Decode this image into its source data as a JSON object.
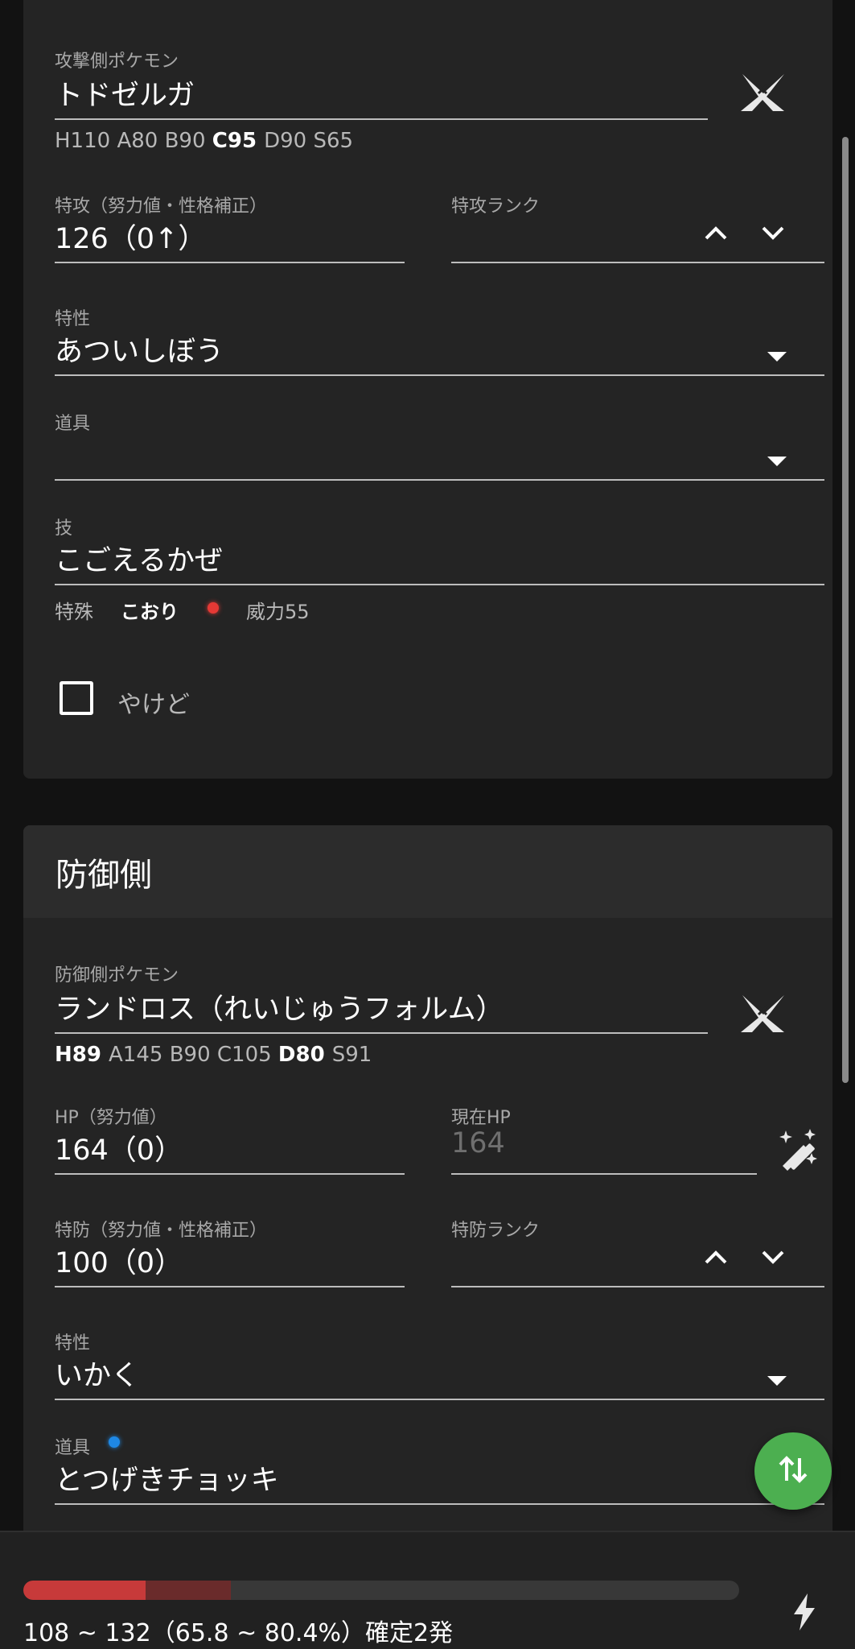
{
  "attacker": {
    "pokemon_label": "攻撃側ポケモン",
    "pokemon_value": "トドゼルガ",
    "stats": [
      {
        "text": "H110",
        "bold": false
      },
      {
        "text": "A80",
        "bold": false
      },
      {
        "text": "B90",
        "bold": false
      },
      {
        "text": "C95",
        "bold": true
      },
      {
        "text": "D90",
        "bold": false
      },
      {
        "text": "S65",
        "bold": false
      }
    ],
    "spatk_label": "特攻（努力値・性格補正）",
    "spatk_value": "126（0↑）",
    "rank_label": "特攻ランク",
    "rank_value": "",
    "ability_label": "特性",
    "ability_value": "あついしぼう",
    "item_label": "道具",
    "item_value": "",
    "move_label": "技",
    "move_value": "こごえるかぜ",
    "move_category": "特殊",
    "move_type": "こおり",
    "move_type_color": "#e53935",
    "move_power": "威力55",
    "burn_label": "やけど",
    "burn_checked": false
  },
  "defender": {
    "section_title": "防御側",
    "pokemon_label": "防御側ポケモン",
    "pokemon_value": "ランドロス（れいじゅうフォルム）",
    "stats": [
      {
        "text": "H89",
        "bold": true
      },
      {
        "text": "A145",
        "bold": false
      },
      {
        "text": "B90",
        "bold": false
      },
      {
        "text": "C105",
        "bold": false
      },
      {
        "text": "D80",
        "bold": true
      },
      {
        "text": "S91",
        "bold": false
      }
    ],
    "hp_label": "HP（努力値）",
    "hp_value": "164（0）",
    "current_hp_label": "現在HP",
    "current_hp_placeholder": "164",
    "spdef_label": "特防（努力値・性格補正）",
    "spdef_value": "100（0）",
    "rank_label": "特防ランク",
    "rank_value": "",
    "ability_label": "特性",
    "ability_value": "いかく",
    "item_label": "道具",
    "item_value": "とつげきチョッキ",
    "item_dot_color": "#1e88e5"
  },
  "result": {
    "min_fraction": 0.658,
    "max_fraction": 0.804,
    "text": "108 ~ 132（65.8 ~ 80.4%）確定2発"
  },
  "colors": {
    "accent_green": "#4caf50",
    "damage_red": "#c73a3a"
  },
  "icons": {
    "swords": "crossed-swords-icon",
    "wand": "magic-wand-icon",
    "swap": "swap-vertical-icon",
    "bolt": "lightning-icon"
  }
}
